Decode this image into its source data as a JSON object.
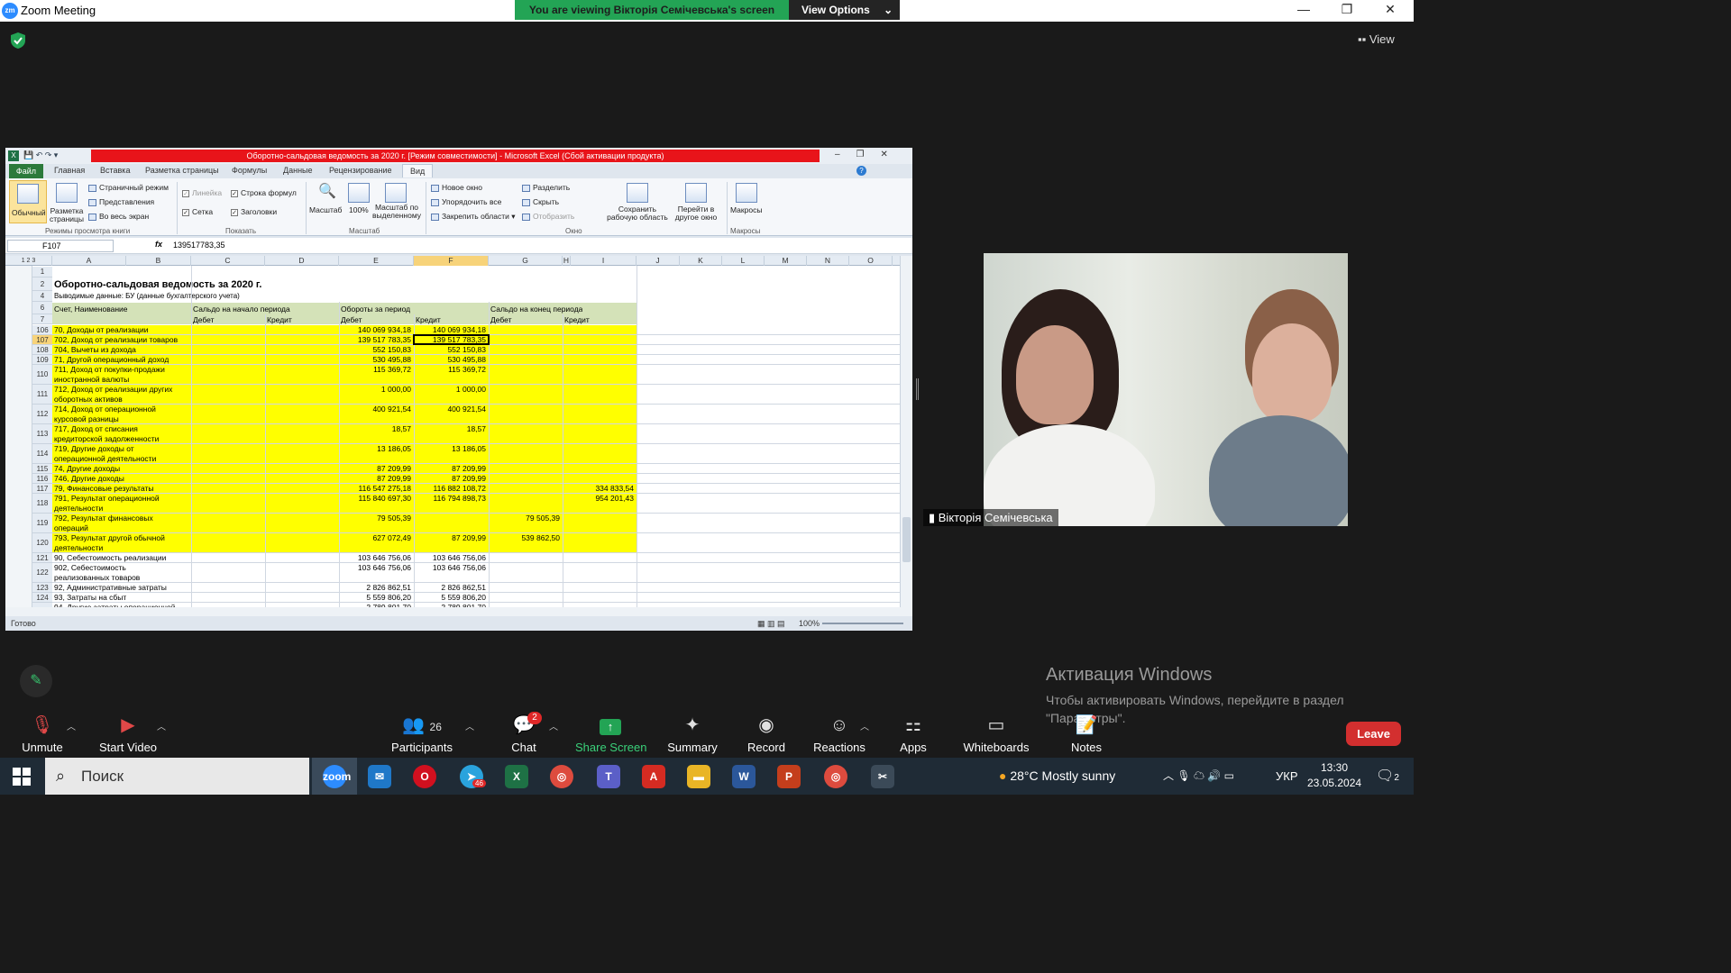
{
  "zoom": {
    "app_title": "Zoom Meeting",
    "banner_text": "You are viewing Вікторія Семічевська's screen",
    "view_options": "View Options",
    "view_label": "View",
    "minimize": "—",
    "restore": "❐",
    "close": "✕"
  },
  "excel": {
    "window_title": "Оборотно-сальдовая ведомость за 2020 г. [Режим совместимости] - Microsoft Excel (Сбой активации продукта)",
    "tabs": [
      "Файл",
      "Главная",
      "Вставка",
      "Разметка страницы",
      "Формулы",
      "Данные",
      "Рецензирование",
      "Вид"
    ],
    "ribbon": {
      "normal": "Обычный",
      "page_layout": "Разметка страницы",
      "page_mode": "Страничный режим",
      "views": "Представления",
      "full_screen": "Во весь экран",
      "group_views": "Режимы просмотра книги",
      "ruler": "Линейка",
      "formula_bar": "Строка формул",
      "gridlines": "Сетка",
      "headings": "Заголовки",
      "group_show": "Показать",
      "zoom": "Масштаб",
      "zoom100": "100%",
      "zoom_sel": "Масштаб по выделенному",
      "group_zoom": "Масштаб",
      "new_window": "Новое окно",
      "arrange_all": "Упорядочить все",
      "freeze": "Закрепить области",
      "split": "Разделить",
      "hide": "Скрыть",
      "unhide": "Отобразить",
      "save_ws": "Сохранить рабочую область",
      "switch_win": "Перейти в другое окно",
      "group_window": "Окно",
      "macros": "Макросы",
      "group_macros": "Макросы"
    },
    "name_box": "F107",
    "fx": "fx",
    "formula": "139517783,35",
    "outline_levels": [
      "1",
      "2",
      "3"
    ],
    "columns": [
      "A",
      "B",
      "C",
      "D",
      "E",
      "F",
      "G",
      "H",
      "I",
      "J",
      "K",
      "L",
      "M",
      "N",
      "O"
    ],
    "sheet": {
      "title": "Оборотно-сальдовая ведомость за 2020 г.",
      "subtitle": "Выводимые данные:  БУ (данные бухгалтерского учета)",
      "h_account": "Счет, Наименование",
      "h_open": "Сальдо на начало периода",
      "h_turn": "Обороты за период",
      "h_close": "Сальдо на конец периода",
      "debit": "Дебет",
      "credit": "Кредит"
    },
    "rows": [
      {
        "n": "106",
        "a": "70, Доходы от реализации",
        "e": "140 069 934,18",
        "f": "140 069 934,18",
        "g": "",
        "i": "",
        "y": true
      },
      {
        "n": "107",
        "a": "   702, Доход от реализации товаров",
        "e": "139 517 783,35",
        "f": "139 517 783,35",
        "g": "",
        "i": "",
        "y": true
      },
      {
        "n": "108",
        "a": "   704, Вычеты из дохода",
        "e": "552 150,83",
        "f": "552 150,83",
        "g": "",
        "i": "",
        "y": true
      },
      {
        "n": "109",
        "a": "71, Другой операционный доход",
        "e": "530 495,88",
        "f": "530 495,88",
        "g": "",
        "i": "",
        "y": true
      },
      {
        "n": "110",
        "a": "   711, Доход от покупки-продажи",
        "a2": "   иностранной валюты",
        "e": "115 369,72",
        "f": "115 369,72",
        "g": "",
        "i": "",
        "y": true
      },
      {
        "n": "111",
        "a": "   712, Доход от реализации других",
        "a2": "   оборотных активов",
        "e": "1 000,00",
        "f": "1 000,00",
        "g": "",
        "i": "",
        "y": true
      },
      {
        "n": "112",
        "a": "   714, Доход от операционной",
        "a2": "   курсовой разницы",
        "e": "400 921,54",
        "f": "400 921,54",
        "g": "",
        "i": "",
        "y": true
      },
      {
        "n": "113",
        "a": "   717, Доход от списания",
        "a2": "   кредиторской задолженности",
        "e": "18,57",
        "f": "18,57",
        "g": "",
        "i": "",
        "y": true
      },
      {
        "n": "114",
        "a": "   719, Другие доходы от",
        "a2": "   операционной деятельности",
        "e": "13 186,05",
        "f": "13 186,05",
        "g": "",
        "i": "",
        "y": true
      },
      {
        "n": "115",
        "a": "74, Другие доходы",
        "e": "87 209,99",
        "f": "87 209,99",
        "g": "",
        "i": "",
        "y": true
      },
      {
        "n": "116",
        "a": "   746, Другие доходы",
        "e": "87 209,99",
        "f": "87 209,99",
        "g": "",
        "i": "",
        "y": true
      },
      {
        "n": "117",
        "a": "79, Финансовые результаты",
        "e": "116 547 275,18",
        "f": "116 882 108,72",
        "g": "",
        "i": "334 833,54",
        "y": true
      },
      {
        "n": "118",
        "a": "   791, Результат операционной",
        "a2": "   деятельности",
        "e": "115 840 697,30",
        "f": "116 794 898,73",
        "g": "",
        "i": "954 201,43",
        "y": true
      },
      {
        "n": "119",
        "a": "   792, Результат финансовых",
        "a2": "   операций",
        "e": "79 505,39",
        "f": "",
        "g": "79 505,39",
        "i": "",
        "y": true
      },
      {
        "n": "120",
        "a": "   793, Результат другой обычной",
        "a2": "   деятельности",
        "e": "627 072,49",
        "f": "87 209,99",
        "g": "539 862,50",
        "i": "",
        "y": true
      },
      {
        "n": "121",
        "a": "90, Себестоимость реализации",
        "e": "103 646 756,06",
        "f": "103 646 756,06",
        "g": "",
        "i": "",
        "y": false
      },
      {
        "n": "122",
        "a": "   902, Себестоимость",
        "a2": "   реализованных товаров",
        "e": "103 646 756,06",
        "f": "103 646 756,06",
        "g": "",
        "i": "",
        "y": false
      },
      {
        "n": "123",
        "a": "92, Административные затраты",
        "e": "2 826 862,51",
        "f": "2 826 862,51",
        "g": "",
        "i": "",
        "y": false
      },
      {
        "n": "124",
        "a": "93, Затраты на сбыт",
        "e": "5 559 806,20",
        "f": "5 559 806,20",
        "g": "",
        "i": "",
        "y": false
      },
      {
        "n": "",
        "a": "94, Другие затраты операционной",
        "e": "2 789 801,70",
        "f": "2 789 801,70",
        "g": "",
        "i": "",
        "y": false
      }
    ],
    "status": "Готово",
    "zoom_level": "100%"
  },
  "video": {
    "participant_name": "Вікторія Семічевська"
  },
  "watermark": {
    "line1": "Активация Windows",
    "line2": "Чтобы активировать Windows, перейдите в раздел",
    "line3": "\"Параметры\"."
  },
  "toolbar": {
    "unmute": "Unmute",
    "start_video": "Start Video",
    "participants": "Participants",
    "participants_count": "26",
    "chat": "Chat",
    "chat_badge": "2",
    "share": "Share Screen",
    "summary": "Summary",
    "record": "Record",
    "reactions": "Reactions",
    "apps": "Apps",
    "whiteboards": "Whiteboards",
    "notes": "Notes",
    "leave": "Leave"
  },
  "taskbar": {
    "search": "Поиск",
    "weather": "28°C  Mostly sunny",
    "lang": "УКР",
    "time": "13:30",
    "date": "23.05.2024",
    "notif": "2",
    "telegram_badge": "46"
  },
  "colors": {
    "zoom_green": "#23a455",
    "excel_red": "#e8141a",
    "highlight": "#ffff00",
    "leave_red": "#d32f2f"
  }
}
